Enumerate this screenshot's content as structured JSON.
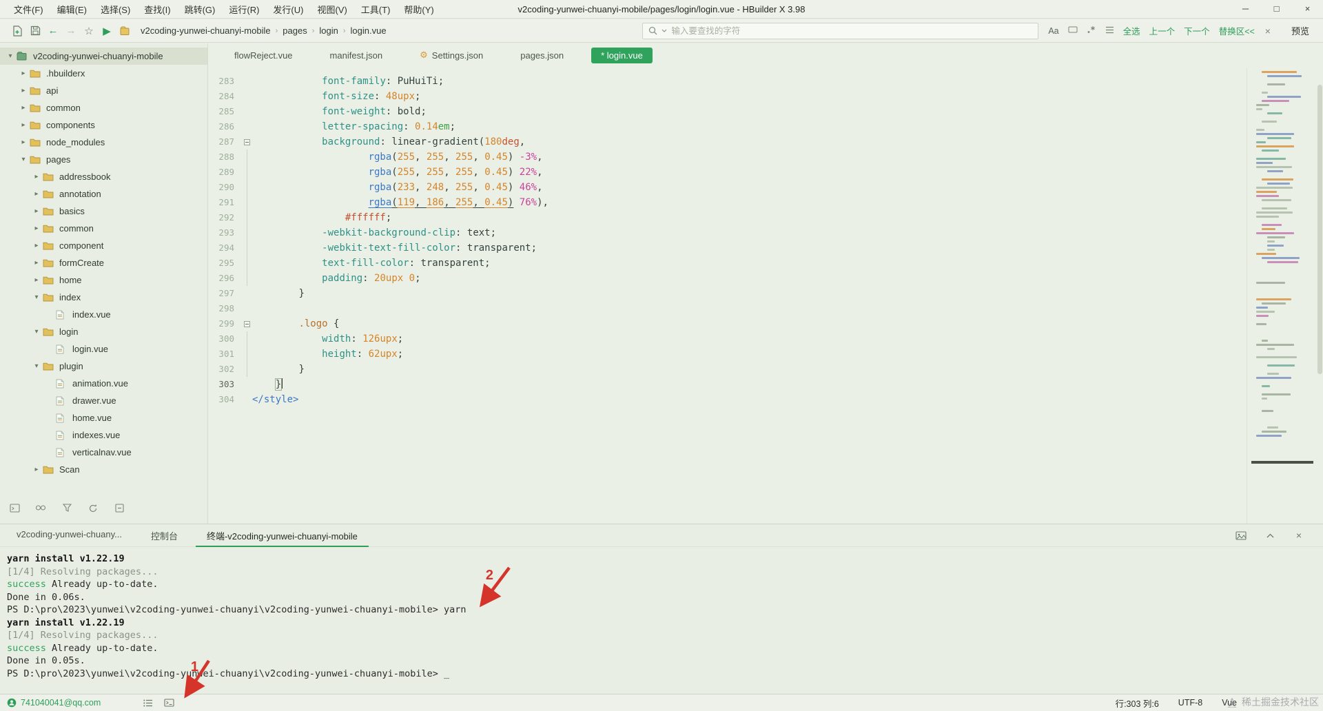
{
  "window": {
    "title": "v2coding-yunwei-chuanyi-mobile/pages/login/login.vue - HBuilder X 3.98",
    "menus": [
      "文件(F)",
      "编辑(E)",
      "选择(S)",
      "查找(I)",
      "跳转(G)",
      "运行(R)",
      "发行(U)",
      "视图(V)",
      "工具(T)",
      "帮助(Y)"
    ],
    "controls": {
      "minimize": "─",
      "maximize": "□",
      "close": "×"
    }
  },
  "toolbar": {
    "breadcrumb": [
      "v2coding-yunwei-chuanyi-mobile",
      "pages",
      "login",
      "login.vue"
    ],
    "search_placeholder": "输入要查找的字符",
    "find_case_label": "Aa",
    "find_actions": [
      "全选",
      "上一个",
      "下一个",
      "替换区<<"
    ],
    "preview_label": "预览"
  },
  "sidebar": {
    "tree": [
      {
        "label": "v2coding-yunwei-chuanyi-mobile",
        "depth": 0,
        "kind": "project",
        "state": "expanded",
        "selected": true
      },
      {
        "label": ".hbuilderx",
        "depth": 1,
        "kind": "folder",
        "state": "collapsed"
      },
      {
        "label": "api",
        "depth": 1,
        "kind": "folder",
        "state": "collapsed"
      },
      {
        "label": "common",
        "depth": 1,
        "kind": "folder",
        "state": "collapsed"
      },
      {
        "label": "components",
        "depth": 1,
        "kind": "folder",
        "state": "collapsed"
      },
      {
        "label": "node_modules",
        "depth": 1,
        "kind": "folder",
        "state": "collapsed"
      },
      {
        "label": "pages",
        "depth": 1,
        "kind": "folder",
        "state": "expanded"
      },
      {
        "label": "addressbook",
        "depth": 2,
        "kind": "folder",
        "state": "collapsed"
      },
      {
        "label": "annotation",
        "depth": 2,
        "kind": "folder",
        "state": "collapsed"
      },
      {
        "label": "basics",
        "depth": 2,
        "kind": "folder",
        "state": "collapsed"
      },
      {
        "label": "common",
        "depth": 2,
        "kind": "folder",
        "state": "collapsed"
      },
      {
        "label": "component",
        "depth": 2,
        "kind": "folder",
        "state": "collapsed"
      },
      {
        "label": "formCreate",
        "depth": 2,
        "kind": "folder",
        "state": "collapsed"
      },
      {
        "label": "home",
        "depth": 2,
        "kind": "folder",
        "state": "collapsed"
      },
      {
        "label": "index",
        "depth": 2,
        "kind": "folder",
        "state": "expanded"
      },
      {
        "label": "index.vue",
        "depth": 3,
        "kind": "file"
      },
      {
        "label": "login",
        "depth": 2,
        "kind": "folder",
        "state": "expanded"
      },
      {
        "label": "login.vue",
        "depth": 3,
        "kind": "file"
      },
      {
        "label": "plugin",
        "depth": 2,
        "kind": "folder",
        "state": "expanded"
      },
      {
        "label": "animation.vue",
        "depth": 3,
        "kind": "file"
      },
      {
        "label": "drawer.vue",
        "depth": 3,
        "kind": "file"
      },
      {
        "label": "home.vue",
        "depth": 3,
        "kind": "file"
      },
      {
        "label": "indexes.vue",
        "depth": 3,
        "kind": "file"
      },
      {
        "label": "verticalnav.vue",
        "depth": 3,
        "kind": "file"
      },
      {
        "label": "Scan",
        "depth": 2,
        "kind": "folder",
        "state": "collapsed"
      }
    ]
  },
  "editor": {
    "tabs": [
      {
        "label": "flowReject.vue"
      },
      {
        "label": "manifest.json"
      },
      {
        "label": "Settings.json",
        "gear": true
      },
      {
        "label": "pages.json"
      },
      {
        "label": "login.vue",
        "active": true,
        "modified": true
      }
    ],
    "lines": [
      {
        "n": 283,
        "ind": 12,
        "toks": [
          [
            "prop",
            "font-family"
          ],
          [
            "pln",
            ": "
          ],
          [
            "pln",
            "PuHuiTi"
          ],
          [
            "pln",
            ";"
          ]
        ]
      },
      {
        "n": 284,
        "ind": 12,
        "toks": [
          [
            "prop",
            "font-size"
          ],
          [
            "pln",
            ": "
          ],
          [
            "num",
            "48upx"
          ],
          [
            "pln",
            ";"
          ]
        ]
      },
      {
        "n": 285,
        "ind": 12,
        "toks": [
          [
            "prop",
            "font-weight"
          ],
          [
            "pln",
            ": "
          ],
          [
            "pln",
            "bold"
          ],
          [
            "pln",
            ";"
          ]
        ]
      },
      {
        "n": 286,
        "ind": 12,
        "toks": [
          [
            "prop",
            "letter-spacing"
          ],
          [
            "pln",
            ": "
          ],
          [
            "num",
            "0.14"
          ],
          [
            "unitg",
            "em"
          ],
          [
            "pln",
            ";"
          ]
        ]
      },
      {
        "n": 287,
        "ind": 12,
        "fold": true,
        "toks": [
          [
            "prop",
            "background"
          ],
          [
            "pln",
            ": "
          ],
          [
            "pln",
            "linear-gradient("
          ],
          [
            "num",
            "180"
          ],
          [
            "unitr",
            "deg"
          ],
          [
            "pln",
            ","
          ]
        ]
      },
      {
        "n": 288,
        "ind": 20,
        "guide": true,
        "toks": [
          [
            "rgba",
            "rgba"
          ],
          [
            "pln",
            "("
          ],
          [
            "num",
            "255"
          ],
          [
            "pln",
            ", "
          ],
          [
            "num",
            "255"
          ],
          [
            "pln",
            ", "
          ],
          [
            "num",
            "255"
          ],
          [
            "pln",
            ", "
          ],
          [
            "num",
            "0.45"
          ],
          [
            "pln",
            ") "
          ],
          [
            "pct",
            "-3%"
          ],
          [
            "pln",
            ","
          ]
        ]
      },
      {
        "n": 289,
        "ind": 20,
        "guide": true,
        "toks": [
          [
            "rgba",
            "rgba"
          ],
          [
            "pln",
            "("
          ],
          [
            "num",
            "255"
          ],
          [
            "pln",
            ", "
          ],
          [
            "num",
            "255"
          ],
          [
            "pln",
            ", "
          ],
          [
            "num",
            "255"
          ],
          [
            "pln",
            ", "
          ],
          [
            "num",
            "0.45"
          ],
          [
            "pln",
            ") "
          ],
          [
            "pct",
            "22%"
          ],
          [
            "pln",
            ","
          ]
        ]
      },
      {
        "n": 290,
        "ind": 20,
        "guide": true,
        "toks": [
          [
            "rgba",
            "rgba"
          ],
          [
            "pln",
            "("
          ],
          [
            "num",
            "233"
          ],
          [
            "pln",
            ", "
          ],
          [
            "num",
            "248"
          ],
          [
            "pln",
            ", "
          ],
          [
            "num",
            "255"
          ],
          [
            "pln",
            ", "
          ],
          [
            "num",
            "0.45"
          ],
          [
            "pln",
            ") "
          ],
          [
            "pct",
            "46%"
          ],
          [
            "pln",
            ","
          ]
        ]
      },
      {
        "n": 291,
        "ind": 20,
        "guide": true,
        "toks": [
          [
            "rgba ul",
            "rgba"
          ],
          [
            "pln ul",
            "("
          ],
          [
            "num ul",
            "119"
          ],
          [
            "pln ul",
            ", "
          ],
          [
            "num ul",
            "186"
          ],
          [
            "pln ul",
            ", "
          ],
          [
            "num ul",
            "255"
          ],
          [
            "pln ul",
            ", "
          ],
          [
            "num ul",
            "0.45"
          ],
          [
            "pln ul",
            ")"
          ],
          [
            "pln",
            " "
          ],
          [
            "pct",
            "76%"
          ],
          [
            "pln",
            "),"
          ]
        ]
      },
      {
        "n": 292,
        "ind": 16,
        "guide": true,
        "toks": [
          [
            "hex",
            "#ffffff"
          ],
          [
            "pln",
            ";"
          ]
        ]
      },
      {
        "n": 293,
        "ind": 12,
        "guide": true,
        "toks": [
          [
            "prop",
            "-webkit-background-clip"
          ],
          [
            "pln",
            ": "
          ],
          [
            "pln",
            "text"
          ],
          [
            "pln",
            ";"
          ]
        ]
      },
      {
        "n": 294,
        "ind": 12,
        "guide": true,
        "toks": [
          [
            "prop",
            "-webkit-text-fill-color"
          ],
          [
            "pln",
            ": "
          ],
          [
            "pln",
            "transparent"
          ],
          [
            "pln",
            ";"
          ]
        ]
      },
      {
        "n": 295,
        "ind": 12,
        "guide": true,
        "toks": [
          [
            "prop",
            "text-fill-color"
          ],
          [
            "pln",
            ": "
          ],
          [
            "pln",
            "transparent"
          ],
          [
            "pln",
            ";"
          ]
        ]
      },
      {
        "n": 296,
        "ind": 12,
        "guide": true,
        "toks": [
          [
            "prop",
            "padding"
          ],
          [
            "pln",
            ": "
          ],
          [
            "num",
            "20upx"
          ],
          [
            "pln",
            " "
          ],
          [
            "num",
            "0"
          ],
          [
            "pln",
            ";"
          ]
        ]
      },
      {
        "n": 297,
        "ind": 8,
        "toks": [
          [
            "pln",
            "}"
          ]
        ]
      },
      {
        "n": 298,
        "ind": 0,
        "toks": []
      },
      {
        "n": 299,
        "ind": 8,
        "fold": true,
        "toks": [
          [
            "cls",
            ".logo"
          ],
          [
            "pln",
            " {"
          ]
        ]
      },
      {
        "n": 300,
        "ind": 12,
        "guide": true,
        "toks": [
          [
            "prop",
            "width"
          ],
          [
            "pln",
            ": "
          ],
          [
            "num",
            "126upx"
          ],
          [
            "pln",
            ";"
          ]
        ]
      },
      {
        "n": 301,
        "ind": 12,
        "guide": true,
        "toks": [
          [
            "prop",
            "height"
          ],
          [
            "pln",
            ": "
          ],
          [
            "num",
            "62upx"
          ],
          [
            "pln",
            ";"
          ]
        ]
      },
      {
        "n": 302,
        "ind": 8,
        "guide": true,
        "toks": [
          [
            "pln",
            "}"
          ]
        ]
      },
      {
        "n": 303,
        "ind": 4,
        "active": true,
        "toks": [
          [
            "pln brk",
            "}"
          ],
          [
            "caret",
            ""
          ]
        ]
      },
      {
        "n": 304,
        "ind": 0,
        "toks": [
          [
            "tag",
            "</style>"
          ]
        ]
      }
    ]
  },
  "console": {
    "tabs": [
      {
        "label": "v2coding-yunwei-chuany..."
      },
      {
        "label": "控制台"
      },
      {
        "label": "终端-v2coding-yunwei-chuanyi-mobile",
        "active": true
      }
    ],
    "terminal": [
      [
        [
          "b",
          "yarn install v1.22.19"
        ]
      ],
      [
        [
          "dim",
          "[1/4] Resolving packages..."
        ]
      ],
      [
        [
          "succ",
          "success"
        ],
        [
          "t",
          " Already up-to-date."
        ]
      ],
      [
        [
          "t",
          "Done in 0.06s."
        ]
      ],
      [
        [
          "t",
          "PS D:\\pro\\2023\\yunwei\\v2coding-yunwei-chuanyi\\v2coding-yunwei-chuanyi-mobile> yarn"
        ]
      ],
      [
        [
          "b",
          "yarn install v1.22.19"
        ]
      ],
      [
        [
          "dim",
          "[1/4] Resolving packages..."
        ]
      ],
      [
        [
          "succ",
          "success"
        ],
        [
          "t",
          " Already up-to-date."
        ]
      ],
      [
        [
          "t",
          "Done in 0.05s."
        ]
      ],
      [
        [
          "t",
          "PS D:\\pro\\2023\\yunwei\\v2coding-yunwei-chuanyi\\v2coding-yunwei-chuanyi-mobile> "
        ],
        [
          "cur",
          "_"
        ]
      ]
    ]
  },
  "statusbar": {
    "account": "741040041@qq.com",
    "cursor": "行:303 列:6",
    "encoding": "UTF-8",
    "language": "Vue"
  },
  "annotations": {
    "labels": [
      "1",
      "2"
    ]
  },
  "watermark": "稀土掘金技术社区"
}
